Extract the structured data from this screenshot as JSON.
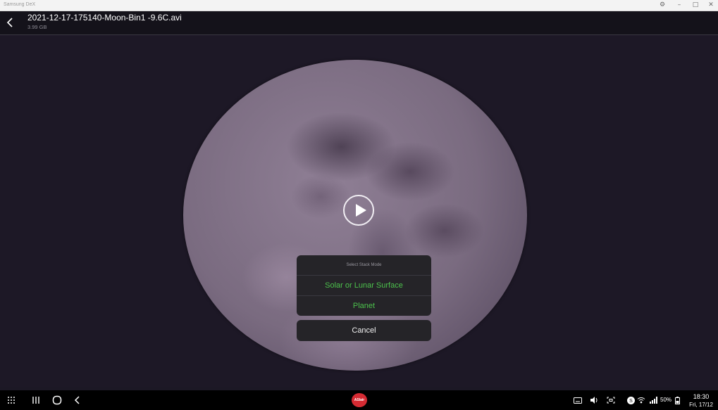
{
  "window": {
    "title": "Samsung DeX",
    "controls": [
      "settings-icon",
      "minimize-icon",
      "maximize-icon",
      "close-icon"
    ]
  },
  "header": {
    "back_icon": "arrow-left-icon",
    "file_name": "2021-12-17-175140-Moon-Bin1 -9.6C.avi",
    "file_size": "3.99 GB"
  },
  "viewer": {
    "play_icon": "play-icon"
  },
  "dialog": {
    "title": "Select Stack Mode",
    "options": [
      "Solar or Lunar Surface",
      "Planet"
    ],
    "cancel_label": "Cancel",
    "option_color": "#4cc24c"
  },
  "taskbar": {
    "app_logo_text": "ASIair",
    "battery": "50%",
    "time": "18:30",
    "date": "Fri, 17/12",
    "icons": [
      "apps-grid-icon",
      "recents-icon",
      "home-icon",
      "back-icon",
      "keyboard-icon",
      "volume-icon",
      "screenshot-icon",
      "samsung-s-icon",
      "wifi-icon",
      "signal-icon",
      "battery-icon"
    ]
  }
}
